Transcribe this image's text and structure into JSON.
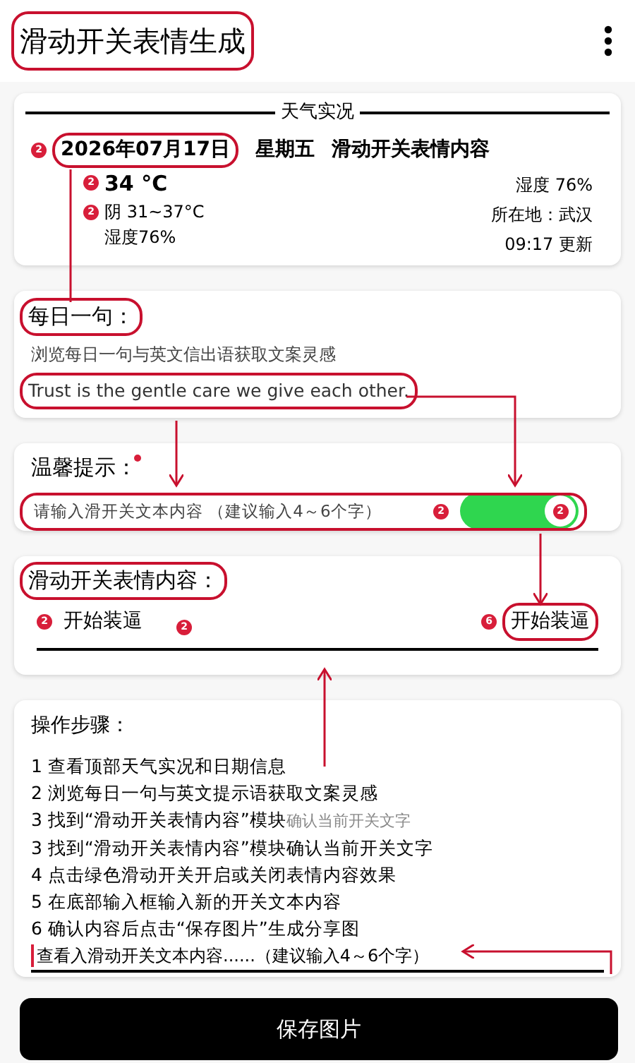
{
  "app_bar": {
    "title": "滑动开关表情生成"
  },
  "weather": {
    "heading": "天气实况",
    "date": "2026年07月17日",
    "date_badge": "2",
    "weekday": "星期五",
    "subtitle": "滑动开关表情内容",
    "temperature": "34 °C",
    "temperature_badge": "2",
    "condition": "阴 31~37°C",
    "condition_badge": "2",
    "humidity_left": "湿度76%",
    "humidity_right": "湿度 76%",
    "location": "所在地：武汉",
    "updated": "09:17 更新"
  },
  "daily": {
    "title": "每日一句：",
    "subtitle": "浏览每日一句与英文信出语获取文案灵感",
    "quote": "Trust is the gentle care we give each other."
  },
  "tip": {
    "title": "温馨提示：",
    "placeholder": "请输入滑开关文本内容 （建议输入4～6个字）",
    "badge": "2",
    "switch": {
      "on": true,
      "badge": "2"
    }
  },
  "content": {
    "title": "滑动开关表情内容：",
    "left_badge": "2",
    "left_text": "开始装逼",
    "middle_badge": "2",
    "right_badge": "6",
    "right_text": "开始装逼"
  },
  "steps": {
    "title": "操作步骤：",
    "items": [
      {
        "text": "1 查看顶部天气实况和日期信息"
      },
      {
        "text": "2 浏览每日一句与英文提示语获取文案灵感"
      },
      {
        "text": "3 找到“滑动开关表情内容”模块",
        "faded": "确认当前开关文字"
      },
      {
        "text": "3 找到“滑动开关表情内容”模块确认当前开关文字"
      },
      {
        "text": "4 点击绿色滑动开关开启或关闭表情内容效果"
      },
      {
        "text": "5 在底部输入框输入新的开关文本内容"
      },
      {
        "text": "6 确认内容后点击“保存图片”生成分享图"
      }
    ],
    "input": {
      "value": "查看入滑动开关文本内容......（建议输入4～6个字）"
    }
  },
  "save_button": {
    "label": "保存图片"
  }
}
